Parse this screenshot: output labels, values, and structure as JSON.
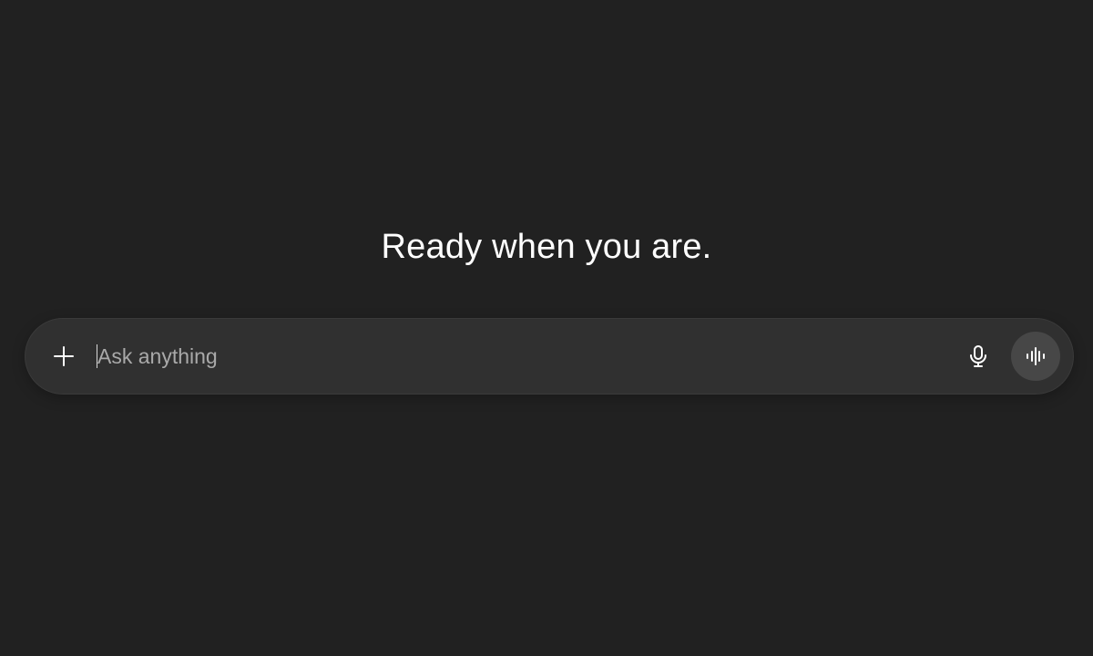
{
  "main": {
    "headline": "Ready when you are."
  },
  "composer": {
    "placeholder": "Ask anything",
    "value": ""
  },
  "icons": {
    "attach": "plus-icon",
    "dictate": "microphone-icon",
    "voice_mode": "voice-waveform-icon"
  },
  "colors": {
    "background": "#212121",
    "composer_background": "#303030",
    "voice_button_background": "#474747",
    "text": "#ffffff",
    "placeholder": "#a9a9a9"
  }
}
